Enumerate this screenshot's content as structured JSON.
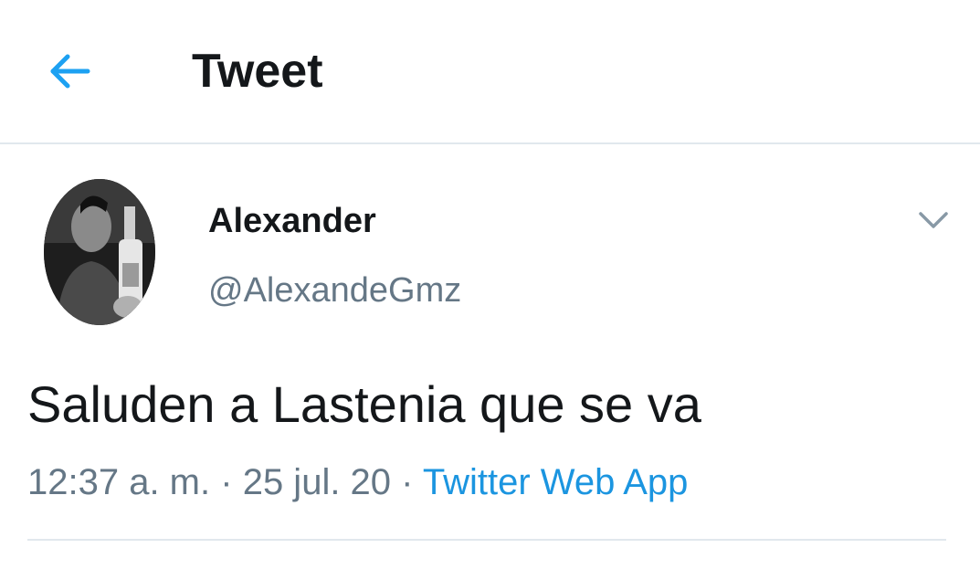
{
  "header": {
    "title": "Tweet",
    "back_icon": "arrow-left-icon",
    "accent_color": "#1da1f2"
  },
  "tweet": {
    "author": {
      "display_name": "Alexander",
      "handle": "@AlexandeGmz",
      "avatar": "profile-photo"
    },
    "more_icon": "chevron-down-icon",
    "text": "Saluden a Lastenia que se va",
    "time": "12:37 a. m.",
    "separator": "·",
    "date": "25 jul. 20",
    "source": "Twitter Web App",
    "source_color": "#1b95e0"
  }
}
